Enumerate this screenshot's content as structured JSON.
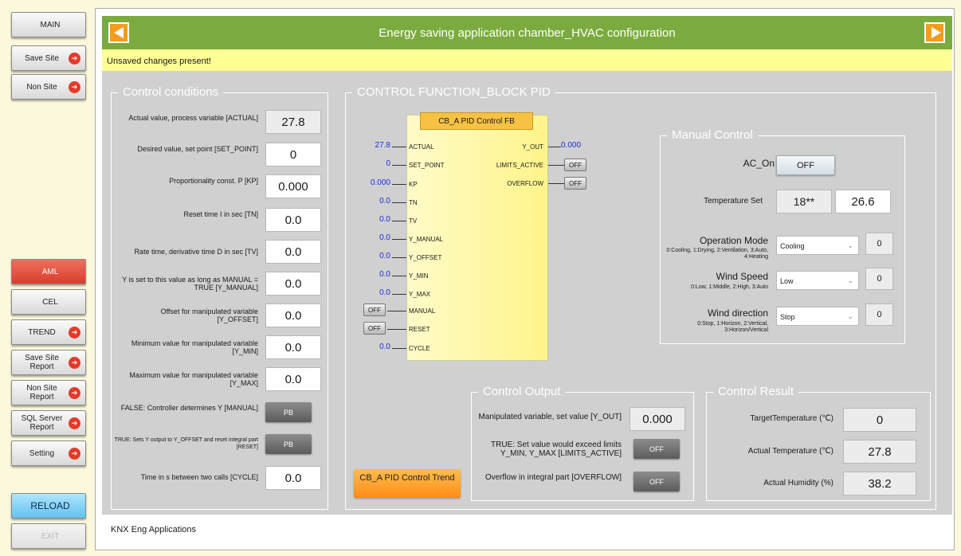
{
  "nav": {
    "main": "MAIN",
    "save_site": "Save Site",
    "non_site": "Non Site",
    "aml": "AML",
    "cel": "CEL",
    "trend": "TREND",
    "save_site_report": "Save Site Report",
    "non_site_report": "Non Site Report",
    "sql_server_report": "SQL Server Report",
    "setting": "Setting",
    "reload": "RELOAD",
    "exit": "EXIT"
  },
  "header": {
    "title": "Energy saving application chamber_HVAC configuration"
  },
  "warning": "Unsaved changes present!",
  "footer": "KNX Eng Applications",
  "control_conditions": {
    "title": "Control conditions",
    "rows": [
      {
        "label": "Actual value, process variable [ACTUAL]",
        "value": "27.8"
      },
      {
        "label": "Desired value, set point [SET_POINT]",
        "value": "0"
      },
      {
        "label": "Proportionality const. P [KP]",
        "value": "0.000"
      },
      {
        "label": "Reset time I in sec [TN]",
        "value": "0.0"
      },
      {
        "label": "Rate time, derivative time D in sec [TV]",
        "value": "0.0"
      },
      {
        "label": "Y is set to this value as long as MANUAL = TRUE [Y_MANUAL]",
        "value": "0.0"
      },
      {
        "label": "Offset for manipulated variable [Y_OFFSET]",
        "value": "0.0"
      },
      {
        "label": "Minimum value for manipulated variable [Y_MIN]",
        "value": "0.0"
      },
      {
        "label": "Maximum value for manipulated variable [Y_MAX]",
        "value": "0.0"
      },
      {
        "label": "FALSE: Controller determines Y [MANUAL]",
        "value": "PB"
      },
      {
        "label": "TRUE: Sets Y output to Y_OFFSET and reset integral part [RESET]",
        "value": "PB"
      },
      {
        "label": "Time in s between two calls [CYCLE]",
        "value": "0.0"
      }
    ]
  },
  "function_block": {
    "section_title": "CONTROL FUNCTION_BLOCK PID",
    "title": "CB_A PID Control FB",
    "inputs": [
      {
        "pin": "ACTUAL",
        "value": "27.8"
      },
      {
        "pin": "SET_POINT",
        "value": "0"
      },
      {
        "pin": "KP",
        "value": "0.000"
      },
      {
        "pin": "TN",
        "value": "0.0"
      },
      {
        "pin": "TV",
        "value": "0.0"
      },
      {
        "pin": "Y_MANUAL",
        "value": "0.0"
      },
      {
        "pin": "Y_OFFSET",
        "value": "0.0"
      },
      {
        "pin": "Y_MIN",
        "value": "0.0"
      },
      {
        "pin": "Y_MAX",
        "value": "0.0"
      },
      {
        "pin": "MANUAL",
        "value": "OFF"
      },
      {
        "pin": "RESET",
        "value": "OFF"
      },
      {
        "pin": "CYCLE",
        "value": "0.0"
      }
    ],
    "outputs": [
      {
        "pin": "Y_OUT",
        "value": "0.000"
      },
      {
        "pin": "LIMITS_ACTIVE",
        "value": "OFF"
      },
      {
        "pin": "OVERFLOW",
        "value": "OFF"
      }
    ]
  },
  "manual_control": {
    "title": "Manual Control",
    "ac_on_label": "AC_On",
    "ac_on_value": "OFF",
    "temp_set_label": "Temperature Set",
    "temp_set_left": "18**",
    "temp_set_right": "26.6",
    "operation_mode": {
      "label": "Operation Mode",
      "hint": "0:Cooling, 1:Drying, 2:Ventilation, 3:Auto, 4:Heating",
      "selected": "Cooling",
      "value": "0"
    },
    "wind_speed": {
      "label": "Wind Speed",
      "hint": "0:Low, 1:Middle, 2:High, 3:Auto",
      "selected": "Low",
      "value": "0"
    },
    "wind_direction": {
      "label": "Wind direction",
      "hint": "0:Stop, 1:Horizon, 2:Vertical, 3:Horizon/Vertical",
      "selected": "Stop",
      "value": "0"
    }
  },
  "control_output": {
    "title": "Control Output",
    "rows": [
      {
        "label": "Manipulated variable, set value [Y_OUT]",
        "value": "0.000"
      },
      {
        "label": "TRUE: Set value would exceed limits Y_MIN, Y_MAX [LIMITS_ACTIVE]",
        "value": "OFF"
      },
      {
        "label": "Overflow in integral part [OVERFLOW]",
        "value": "OFF"
      }
    ]
  },
  "control_result": {
    "title": "Control Result",
    "rows": [
      {
        "label": "TargetTemperature (℃)",
        "value": "0"
      },
      {
        "label": "Actual Temperature (℃)",
        "value": "27.8"
      },
      {
        "label": "Actual Humidity (%)",
        "value": "38.2"
      }
    ]
  },
  "trend_button": "CB_A PID Control Trend",
  "colors": {
    "header_green": "#7bab3e",
    "warning_yellow": "#ffff96",
    "panel_gray": "#d0d0d0",
    "aml_red": "#d93d2b",
    "reload_blue": "#63c2ef",
    "value_blue": "#1a2fd6"
  },
  "icons": {
    "nav_arrow": "arrow-right-circle-icon",
    "header_left": "triangle-left-icon",
    "header_right": "triangle-right-icon"
  }
}
